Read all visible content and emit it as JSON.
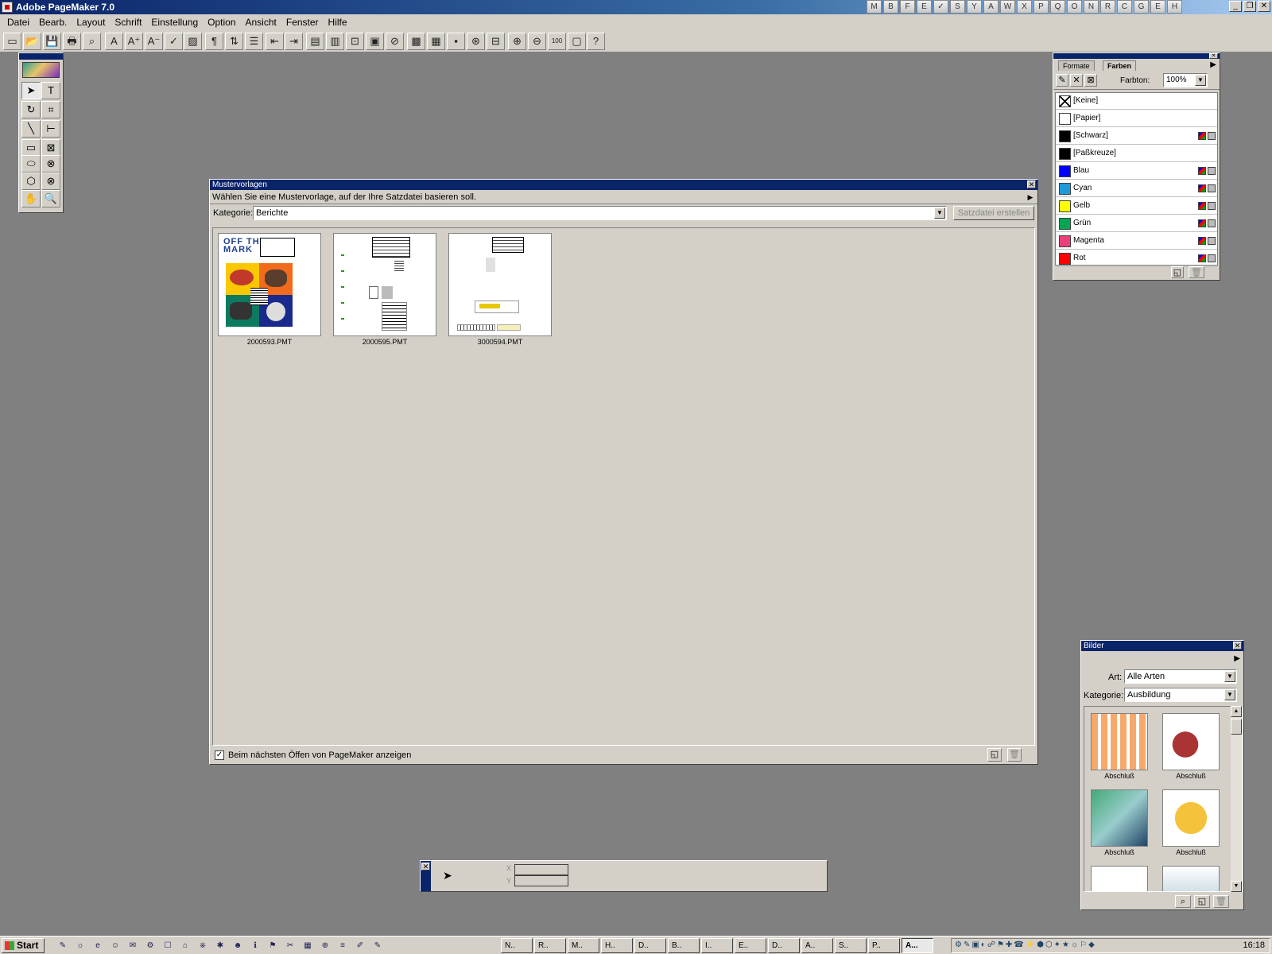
{
  "window": {
    "title": "Adobe PageMaker 7.0"
  },
  "title_quicklaunch": [
    "M",
    "B",
    "F",
    "E",
    "✓",
    "S",
    "Y",
    "A",
    "W",
    "X",
    "P",
    "Q",
    "O",
    "N",
    "R",
    "C",
    "G",
    "E",
    "H"
  ],
  "menu": [
    "Datei",
    "Bearb.",
    "Layout",
    "Schrift",
    "Einstellung",
    "Option",
    "Ansicht",
    "Fenster",
    "Hilfe"
  ],
  "toolbar_icons": [
    "new-document",
    "open",
    "save",
    "print",
    "find",
    "character-spec",
    "increase-size",
    "decrease-size",
    "spelling",
    "fill",
    "paragraph",
    "sort",
    "bullets",
    "indent-left",
    "indent-right",
    "page-layout",
    "pages",
    "place",
    "frame",
    "link",
    "color",
    "image",
    "photo",
    "globe",
    "text-frame",
    "zoom-in",
    "zoom-out",
    "100-percent",
    "fit",
    "help"
  ],
  "toolbox": {
    "tools": [
      "pointer",
      "text",
      "rotate",
      "crop",
      "line",
      "constrained-line",
      "rectangle",
      "rectangle-frame",
      "ellipse",
      "ellipse-frame",
      "polygon",
      "polygon-frame",
      "hand",
      "zoom"
    ]
  },
  "templates": {
    "title": "Mustervorlagen",
    "description": "Wählen Sie eine Mustervorlage, auf der Ihre Satzdatei basieren soll.",
    "category_label": "Kategorie:",
    "category_value": "Berichte",
    "create_button": "Satzdatei erstellen",
    "thumbnail_text": [
      "OFF THE",
      "MARK"
    ],
    "items": [
      {
        "file": "2000593.PMT"
      },
      {
        "file": "2000595.PMT"
      },
      {
        "file": "3000594.PMT"
      }
    ],
    "show_on_startup_label": "Beim nächsten Öffen von PageMaker anzeigen",
    "show_on_startup_checked": true
  },
  "colors_panel": {
    "tabs": [
      "Formate",
      "Farben"
    ],
    "active_tab": "Farben",
    "tint_label": "Farbton:",
    "tint_value": "100%",
    "swatches": [
      {
        "name": "[Keine]",
        "color": "none"
      },
      {
        "name": "[Papier]",
        "color": "#ffffff"
      },
      {
        "name": "[Schwarz]",
        "color": "#000000"
      },
      {
        "name": "[Paßkreuze]",
        "color": "#000000"
      },
      {
        "name": "Blau",
        "color": "#0000ff"
      },
      {
        "name": "Cyan",
        "color": "#1e9bd7"
      },
      {
        "name": "Gelb",
        "color": "#ffff00"
      },
      {
        "name": "Grün",
        "color": "#00a651"
      },
      {
        "name": "Magenta",
        "color": "#ec407a"
      },
      {
        "name": "Rot",
        "color": "#ff0000"
      }
    ]
  },
  "images_panel": {
    "title": "Bilder",
    "type_label": "Art:",
    "type_value": "Alle Arten",
    "category_label": "Kategorie:",
    "category_value": "Ausbildung",
    "items": [
      {
        "caption": "Abschluß"
      },
      {
        "caption": "Abschluß"
      },
      {
        "caption": "Abschluß"
      },
      {
        "caption": "Abschluß"
      },
      {
        "caption": ""
      },
      {
        "caption": ""
      }
    ]
  },
  "control_palette": {
    "x_label": "X",
    "y_label": "Y"
  },
  "taskbar": {
    "start": "Start",
    "quick_launch": [
      "✎",
      "☼",
      "e",
      "☺",
      "✉",
      "⚙",
      "☐",
      "⌂",
      "⎈",
      "✱",
      "☻",
      "ℹ",
      "⚑",
      "✂",
      "▦",
      "⊕",
      "≡",
      "✐",
      "✎"
    ],
    "tasks": [
      "N..",
      "R..",
      "M..",
      "H..",
      "D..",
      "B..",
      "I..",
      "E..",
      "D..",
      "A..",
      "S..",
      "P..",
      "A..."
    ],
    "active_task": "A...",
    "clock": "16:18"
  }
}
